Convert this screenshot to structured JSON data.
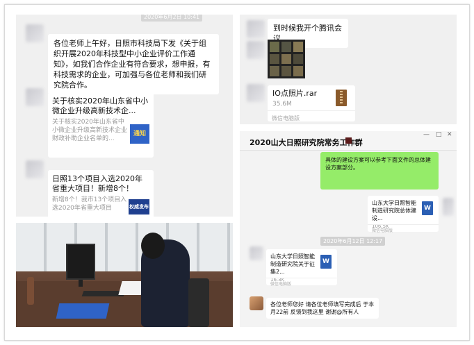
{
  "left_chat": {
    "top_timestamp": "2020年6月2日 10:41",
    "message1": "各位老师上午好，日照市科技局下发《关于组织开展2020年科技型中小企业评价工作通知》，如我们合作企业有符合要求，想申报，有科技需求的企业，可加强与各位老师和我们研究院合作。",
    "card1": {
      "title": "关于核实2020年山东省中小微企业升级高新技术企...",
      "subtitle": "关于核实2020年山东省中小微企业升级高新技术企业财政补助企业名单的...",
      "thumb_label": "通知"
    },
    "card2": {
      "title": "日照13个项目入选2020年省重大项目！新增8个！",
      "subtitle": "新增8个！我市13个项目入选2020年省重大项目",
      "thumb_label": "权威发布"
    }
  },
  "right_top": {
    "message_text": "到时候我开个腾讯会议",
    "file": {
      "name": "IO点照片.rar",
      "size": "35.6M",
      "source": "微信电脑版"
    }
  },
  "right_chat": {
    "title": "2020山大日照研究院常务工作群",
    "window_controls": [
      "—",
      "□",
      "✕"
    ],
    "green_message": "具体的建设方案可以参考下面文件的总体建设方案部分。",
    "file1": {
      "name": "山东大学日照智能制造研究院总体建设...",
      "size": "106.5K",
      "source": "微信电脑版"
    },
    "timestamp": "2020年6月12日 12:17",
    "file2": {
      "name": "山东大学日照智能制造研究院关于征集2...",
      "size": "16.3K",
      "source": "微信电脑版"
    },
    "last_message": "各位老师您好  请各位老师填写完成后 于本月22前 反馈到我这里  谢谢@所有人"
  },
  "colors": {
    "chat_bg": "#f0f0f0",
    "green_bubble": "#95ec69",
    "word_blue": "#2b5fb4"
  }
}
